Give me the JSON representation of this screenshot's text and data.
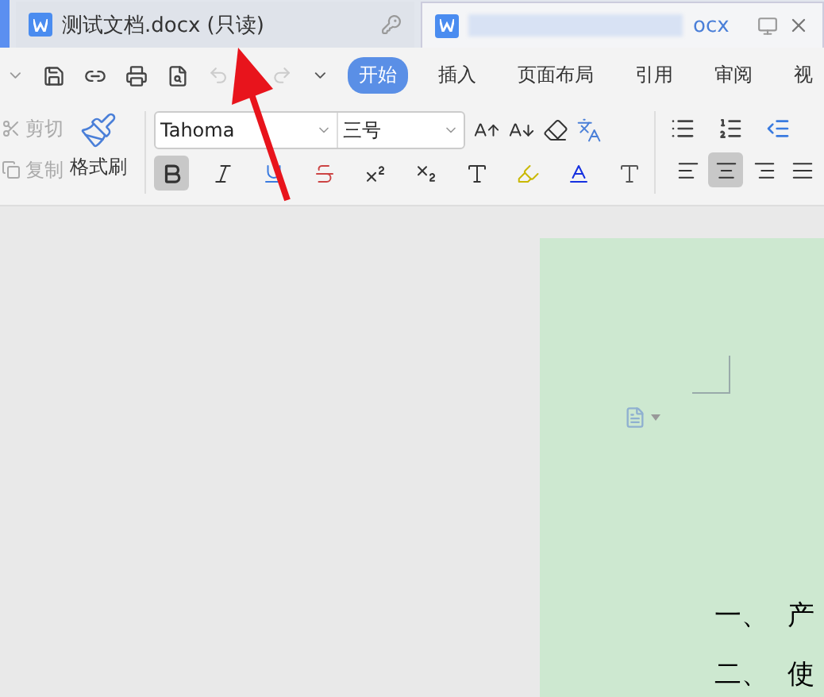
{
  "tabs": [
    {
      "title": "测试文档.docx (只读)",
      "selected": false,
      "read_only": true
    },
    {
      "title": "ocx",
      "selected": true,
      "read_only": false
    }
  ],
  "ribbon_tabs": [
    {
      "label": "开始",
      "selected": true
    },
    {
      "label": "插入",
      "selected": false
    },
    {
      "label": "页面布局",
      "selected": false
    },
    {
      "label": "引用",
      "selected": false
    },
    {
      "label": "审阅",
      "selected": false
    },
    {
      "label": "视",
      "selected": false
    }
  ],
  "clipboard": [
    {
      "label": "剪切",
      "disabled": true
    },
    {
      "label": "复制",
      "disabled": true
    }
  ],
  "format_painter": "格式刷",
  "font": {
    "name": "Tahoma",
    "size": "三号"
  },
  "format_buttons": [
    {
      "kind": "bold",
      "selected": true
    },
    {
      "kind": "italic",
      "selected": false
    },
    {
      "kind": "underline",
      "selected": false
    },
    {
      "kind": "strike",
      "selected": false
    },
    {
      "kind": "sup",
      "selected": false
    },
    {
      "kind": "sub",
      "selected": false
    },
    {
      "kind": "effect",
      "selected": false
    },
    {
      "kind": "highlight",
      "selected": false
    },
    {
      "kind": "color",
      "selected": false
    },
    {
      "kind": "shade",
      "selected": false
    }
  ],
  "align_buttons": [
    {
      "kind": "left",
      "selected": false
    },
    {
      "kind": "center",
      "selected": true
    },
    {
      "kind": "right",
      "selected": false
    },
    {
      "kind": "justify",
      "selected": false
    }
  ],
  "document": {
    "lines": [
      {
        "number": "一、",
        "text": "产"
      },
      {
        "number": "二、",
        "text": "使"
      }
    ]
  }
}
